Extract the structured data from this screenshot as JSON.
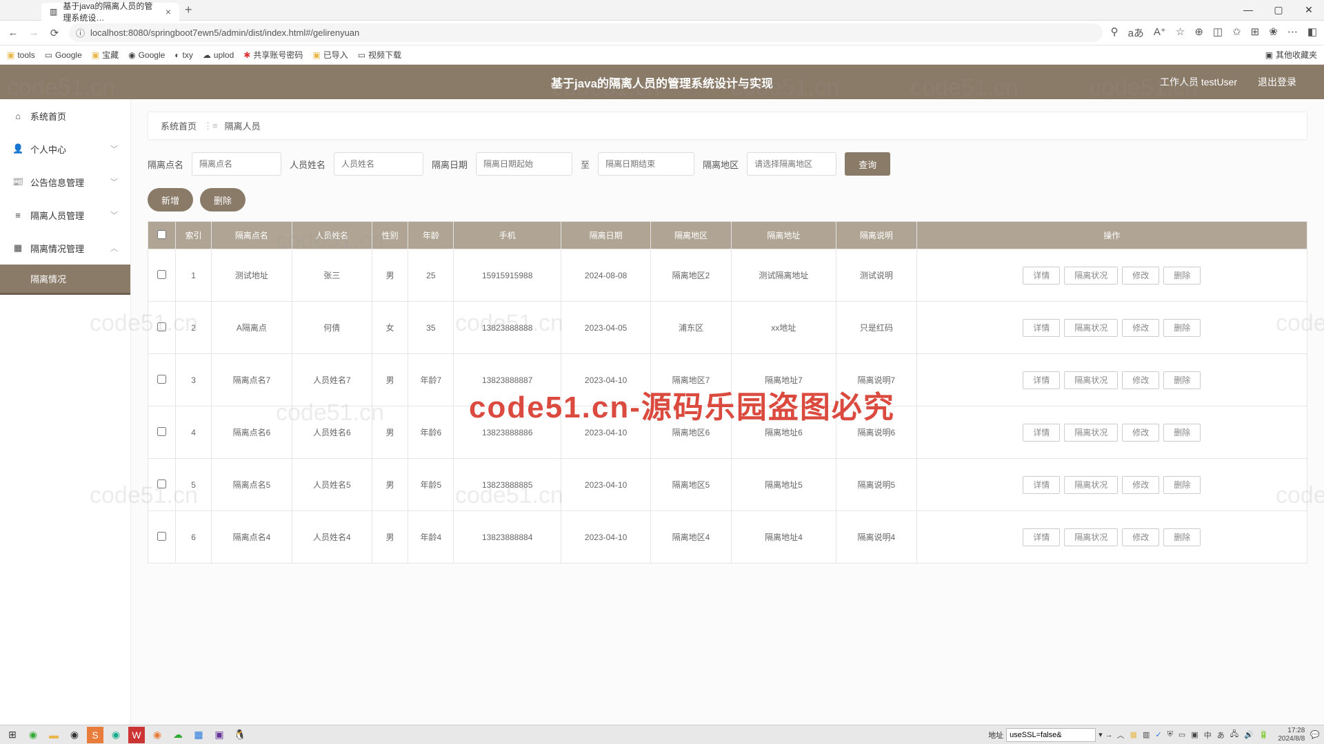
{
  "browser": {
    "tab_title": "基于java的隔离人员的管理系统设…",
    "url": "localhost:8080/springboot7ewn5/admin/dist/index.html#/gelirenyuan",
    "new_tab": "+",
    "close": "×",
    "bookmarks": [
      "tools",
      "Google",
      "宝藏",
      "Google",
      "txy",
      "uplod",
      "共享账号密码",
      "已导入",
      "视频下载"
    ],
    "bookmark_right": "其他收藏夹"
  },
  "header": {
    "title": "基于java的隔离人员的管理系统设计与实现",
    "user_label": "工作人员 testUser",
    "logout": "退出登录"
  },
  "sidebar": {
    "items": [
      {
        "icon": "⌂",
        "label": "系统首页",
        "chev": ""
      },
      {
        "icon": "👤",
        "label": "个人中心",
        "chev": "﹀"
      },
      {
        "icon": "📰",
        "label": "公告信息管理",
        "chev": "﹀"
      },
      {
        "icon": "≡",
        "label": "隔离人员管理",
        "chev": "﹀"
      },
      {
        "icon": "▦",
        "label": "隔离情况管理",
        "chev": "︿"
      }
    ],
    "sub_active": "隔离情况"
  },
  "crumb": {
    "home": "系统首页",
    "current": "隔离人员"
  },
  "filters": {
    "f1_label": "隔离点名",
    "f1_ph": "隔离点名",
    "f2_label": "人员姓名",
    "f2_ph": "人员姓名",
    "f3_label": "隔离日期",
    "f3a_ph": "隔离日期起始",
    "to": "至",
    "f3b_ph": "隔离日期结束",
    "f4_label": "隔离地区",
    "f4_ph": "请选择隔离地区",
    "query": "查询"
  },
  "actions": {
    "add": "新增",
    "del": "删除"
  },
  "table": {
    "headers": [
      "",
      "索引",
      "隔离点名",
      "人员姓名",
      "性别",
      "年龄",
      "手机",
      "隔离日期",
      "隔离地区",
      "隔离地址",
      "隔离说明",
      "操作"
    ],
    "row_actions": [
      "详情",
      "隔离状况",
      "修改",
      "删除"
    ],
    "rows": [
      {
        "idx": "1",
        "point": "测试地址",
        "name": "张三",
        "sex": "男",
        "age": "25",
        "phone": "15915915988",
        "date": "2024-08-08",
        "area": "隔离地区2",
        "addr": "测试隔离地址",
        "note": "测试说明"
      },
      {
        "idx": "2",
        "point": "A隔离点",
        "name": "何倩",
        "sex": "女",
        "age": "35",
        "phone": "13823888888",
        "date": "2023-04-05",
        "area": "浦东区",
        "addr": "xx地址",
        "note": "只是红码"
      },
      {
        "idx": "3",
        "point": "隔离点名7",
        "name": "人员姓名7",
        "sex": "男",
        "age": "年龄7",
        "phone": "13823888887",
        "date": "2023-04-10",
        "area": "隔离地区7",
        "addr": "隔离地址7",
        "note": "隔离说明7"
      },
      {
        "idx": "4",
        "point": "隔离点名6",
        "name": "人员姓名6",
        "sex": "男",
        "age": "年龄6",
        "phone": "13823888886",
        "date": "2023-04-10",
        "area": "隔离地区6",
        "addr": "隔离地址6",
        "note": "隔离说明6"
      },
      {
        "idx": "5",
        "point": "隔离点名5",
        "name": "人员姓名5",
        "sex": "男",
        "age": "年龄5",
        "phone": "13823888885",
        "date": "2023-04-10",
        "area": "隔离地区5",
        "addr": "隔离地址5",
        "note": "隔离说明5"
      },
      {
        "idx": "6",
        "point": "隔离点名4",
        "name": "人员姓名4",
        "sex": "男",
        "age": "年龄4",
        "phone": "13823888884",
        "date": "2023-04-10",
        "area": "隔离地区4",
        "addr": "隔离地址4",
        "note": "隔离说明4"
      }
    ]
  },
  "watermark": "code51.cn",
  "big_watermark": "code51.cn-源码乐园盗图必究",
  "taskbar": {
    "addr_label": "地址",
    "addr_value": "useSSL=false&",
    "time": "17:28",
    "date": "2024/8/8"
  }
}
